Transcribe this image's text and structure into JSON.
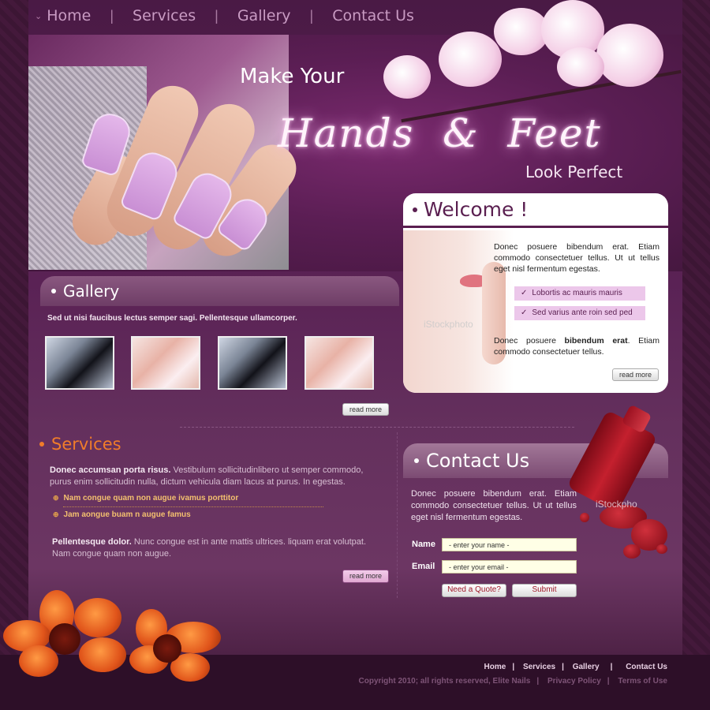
{
  "nav": {
    "items": [
      "Home",
      "Services",
      "Gallery",
      "Contact Us"
    ]
  },
  "hero": {
    "line1": "Make Your",
    "line2": "Hands  &  Feet",
    "line3": "Look Perfect"
  },
  "welcome": {
    "title": "Welcome !",
    "para1": "Donec posuere bibendum erat. Etiam commodo consectetuer tellus. Ut ut tellus eget nisl fermentum egestas.",
    "bullets": [
      "Lobortis ac mauris mauris",
      "Sed varius ante roin sed ped"
    ],
    "para2_prefix": "Donec posuere ",
    "para2_bold": "bibendum erat",
    "para2_suffix": ". Etiam commodo consectetuer tellus.",
    "read_more": "read more",
    "watermark": "iStockphoto"
  },
  "gallery": {
    "title": "Gallery",
    "subtitle": "Sed ut nisi faucibus lectus semper sagi.  Pellentesque ullamcorper.",
    "read_more": "read more"
  },
  "services": {
    "title": "Services",
    "para1_bold": "Donec accumsan porta risus.",
    "para1_rest": " Vestibulum sollicitudinlibero ut semper commodo, purus enim sollicitudin nulla, dictum vehicula diam lacus at purus. In egestas.",
    "items": [
      "Nam congue quam non augue ivamus porttitor",
      "Jam aongue buam n augue famus"
    ],
    "para2_bold": "Pellentesque dolor.",
    "para2_rest": " Nunc congue est in ante mattis ultrices. liquam erat volutpat. Nam congue quam non augue.",
    "read_more": "read more"
  },
  "contact": {
    "title": "Contact Us",
    "text": "Donec posuere bibendum erat. Etiam commodo consectetuer tellus. Ut ut tellus eget nisl fermentum egestas.",
    "name_label": "Name",
    "name_value": "- enter your name -",
    "email_label": "Email",
    "email_value": "- enter your email -",
    "quote_button": "Need a Quote?",
    "submit_button": "Submit",
    "watermark": "iStockpho"
  },
  "footer": {
    "nav": [
      "Home",
      "Services",
      "Gallery",
      "Contact Us"
    ],
    "copyright": "Copyright 2010; all rights reserved, Elite Nails",
    "privacy": "Privacy Policy",
    "terms": "Terms of Use"
  }
}
